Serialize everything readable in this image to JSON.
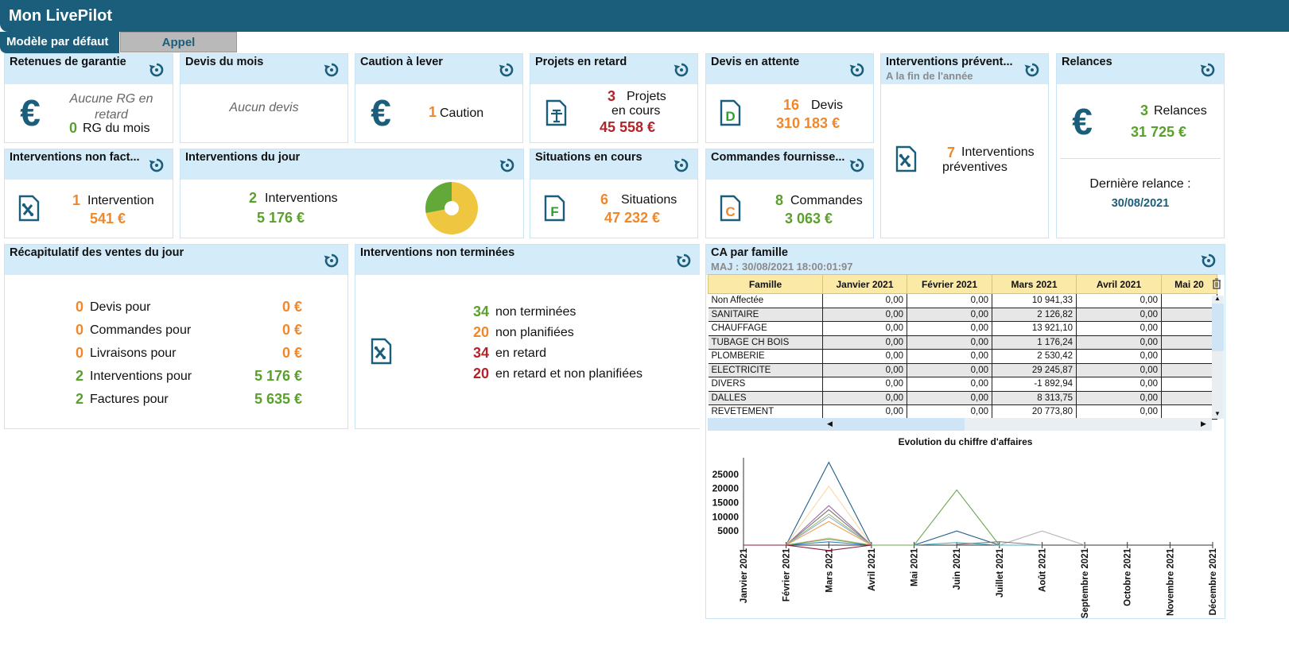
{
  "app": {
    "title": "Mon LivePilot"
  },
  "tabs": [
    {
      "label": "Modèle par défaut"
    },
    {
      "label": "Appel"
    }
  ],
  "cards": {
    "retenues": {
      "title": "Retenues de garantie",
      "line1": "Aucune RG en",
      "line2": "retard",
      "count": "0",
      "count_label": "RG du mois"
    },
    "devis_mois": {
      "title": "Devis du mois",
      "empty": "Aucun devis"
    },
    "caution": {
      "title": "Caution à lever",
      "count": "1",
      "label": "Caution"
    },
    "projets": {
      "title": "Projets  en retard",
      "count": "3",
      "label1": "Projets",
      "label2": "en cours",
      "amount": "45 558 €"
    },
    "devis_attente": {
      "title": "Devis en attente",
      "count": "16",
      "label": "Devis",
      "amount": "310 183 €"
    },
    "interv_prev": {
      "title": "Interventions prévent...",
      "subtitle": "A la fin de l'année",
      "count": "7",
      "label1": "Interventions",
      "label2": "préventives"
    },
    "relances": {
      "title": "Relances",
      "count": "3",
      "label": "Relances",
      "amount": "31 725 €",
      "last_label": "Dernière relance :",
      "last_date": "30/08/2021"
    },
    "interv_nonfact": {
      "title": "Interventions non fact...",
      "count": "1",
      "label": "Intervention",
      "amount": "541 €"
    },
    "interv_jour": {
      "title": "Interventions du jour",
      "count": "2",
      "label": "Interventions",
      "amount": "5 176 €",
      "pie": {
        "green_fraction": 0.28
      }
    },
    "situations": {
      "title": "Situations en cours",
      "count": "6",
      "label": "Situations",
      "amount": "47 232 €"
    },
    "commandes": {
      "title": "Commandes fournisse...",
      "count": "8",
      "label": "Commandes",
      "amount": "3 063 €"
    },
    "recap": {
      "title": "Récapitulatif des ventes du jour",
      "rows": [
        {
          "count": "0",
          "label": "Devis pour",
          "amount": "0 €",
          "color": "#f0882a"
        },
        {
          "count": "0",
          "label": "Commandes pour",
          "amount": "0 €",
          "color": "#f0882a"
        },
        {
          "count": "0",
          "label": "Livraisons pour",
          "amount": "0 €",
          "color": "#f0882a"
        },
        {
          "count": "2",
          "label": "Interventions pour",
          "amount": "5 176 €",
          "color": "#5aa02c"
        },
        {
          "count": "2",
          "label": "Factures pour",
          "amount": "5 635 €",
          "color": "#5aa02c"
        }
      ]
    },
    "interv_nonterm": {
      "title": "Interventions non terminées",
      "rows": [
        {
          "count": "34",
          "label": "non terminées",
          "color": "#5aa02c"
        },
        {
          "count": "20",
          "label": "non planifiées",
          "color": "#f0882a"
        },
        {
          "count": "34",
          "label": "en retard",
          "color": "#b0242a"
        },
        {
          "count": "20",
          "label": "en retard et non planifiées",
          "color": "#b0242a"
        }
      ]
    },
    "ca": {
      "title": "CA par famille",
      "subtitle": "MAJ : 30/08/2021 18:00:01:97",
      "columns": [
        "Famille",
        "Janvier 2021",
        "Février 2021",
        "Mars 2021",
        "Avril 2021",
        "Mai 20"
      ],
      "rows": [
        [
          "Non Affectée",
          "0,00",
          "0,00",
          "10 941,33",
          "0,00",
          ""
        ],
        [
          "SANITAIRE",
          "0,00",
          "0,00",
          "2 126,82",
          "0,00",
          ""
        ],
        [
          "CHAUFFAGE",
          "0,00",
          "0,00",
          "13 921,10",
          "0,00",
          ""
        ],
        [
          "TUBAGE CH BOIS",
          "0,00",
          "0,00",
          "1 176,24",
          "0,00",
          ""
        ],
        [
          "PLOMBERIE",
          "0,00",
          "0,00",
          "2 530,42",
          "0,00",
          ""
        ],
        [
          "ELECTRICITE",
          "0,00",
          "0,00",
          "29 245,87",
          "0,00",
          ""
        ],
        [
          "DIVERS",
          "0,00",
          "0,00",
          "-1 892,94",
          "0,00",
          ""
        ],
        [
          "DALLES",
          "0,00",
          "0,00",
          "8 313,75",
          "0,00",
          ""
        ],
        [
          "REVETEMENT",
          "0,00",
          "0,00",
          "20 773,80",
          "0,00",
          ""
        ]
      ]
    }
  },
  "chart_data": {
    "type": "line",
    "title": "Evolution du chiffre d'affaires",
    "categories": [
      "Janvier 2021",
      "Février 2021",
      "Mars 2021",
      "Avril 2021",
      "Mai 2021",
      "Juin 2021",
      "Juillet 2021",
      "Août 2021",
      "Septembre 2021",
      "Octobre 2021",
      "Novembre 2021",
      "Décembre 2021"
    ],
    "yticks": [
      5000,
      10000,
      15000,
      20000,
      25000
    ],
    "ylim": [
      -2500,
      30000
    ],
    "series": [
      {
        "color": "#1f5f8b",
        "values": [
          0,
          0,
          29245.87,
          0,
          0,
          5000,
          0,
          null,
          null,
          null,
          null,
          null
        ]
      },
      {
        "color": "#f7d9a8",
        "values": [
          0,
          0,
          20773.8,
          0,
          null,
          null,
          null,
          null,
          null,
          null,
          null,
          null
        ]
      },
      {
        "color": "#9e6fa8",
        "values": [
          0,
          0,
          13921.1,
          0,
          null,
          null,
          null,
          null,
          null,
          null,
          null,
          null
        ]
      },
      {
        "color": "#7d7d7d",
        "values": [
          0,
          0,
          12500,
          0,
          null,
          null,
          null,
          null,
          null,
          null,
          null,
          null
        ]
      },
      {
        "color": "#a6bd70",
        "values": [
          0,
          0,
          10941.33,
          0,
          null,
          null,
          null,
          null,
          null,
          null,
          null,
          null
        ]
      },
      {
        "color": "#8fb0d8",
        "values": [
          0,
          0,
          10000,
          0,
          null,
          null,
          null,
          null,
          null,
          null,
          null,
          null
        ]
      },
      {
        "color": "#f0a050",
        "values": [
          0,
          0,
          8313.75,
          0,
          null,
          null,
          null,
          null,
          null,
          null,
          null,
          null
        ]
      },
      {
        "color": "#e4b88a",
        "values": [
          0,
          0,
          2530.42,
          0,
          null,
          null,
          null,
          null,
          null,
          null,
          null,
          null
        ]
      },
      {
        "color": "#6aa84f",
        "values": [
          0,
          0,
          2126.82,
          0,
          0,
          19500,
          0,
          null,
          null,
          null,
          null,
          null
        ]
      },
      {
        "color": "#3a7fc0",
        "values": [
          0,
          0,
          1176.24,
          0,
          null,
          null,
          null,
          null,
          null,
          null,
          null,
          null
        ]
      },
      {
        "color": "#8a1f3a",
        "values": [
          0,
          0,
          -1892.94,
          0,
          null,
          null,
          null,
          null,
          null,
          null,
          null,
          null
        ]
      },
      {
        "color": "#4ab0c0",
        "values": [
          null,
          null,
          null,
          null,
          0,
          900,
          0,
          0,
          null,
          null,
          null,
          null
        ]
      },
      {
        "color": "#b5b5b5",
        "values": [
          null,
          null,
          null,
          null,
          null,
          null,
          0,
          5000,
          0,
          null,
          null,
          null
        ]
      },
      {
        "color": "#7d7d7d",
        "values": [
          null,
          null,
          null,
          null,
          null,
          300,
          1200,
          0,
          null,
          null,
          null,
          null
        ]
      }
    ]
  }
}
